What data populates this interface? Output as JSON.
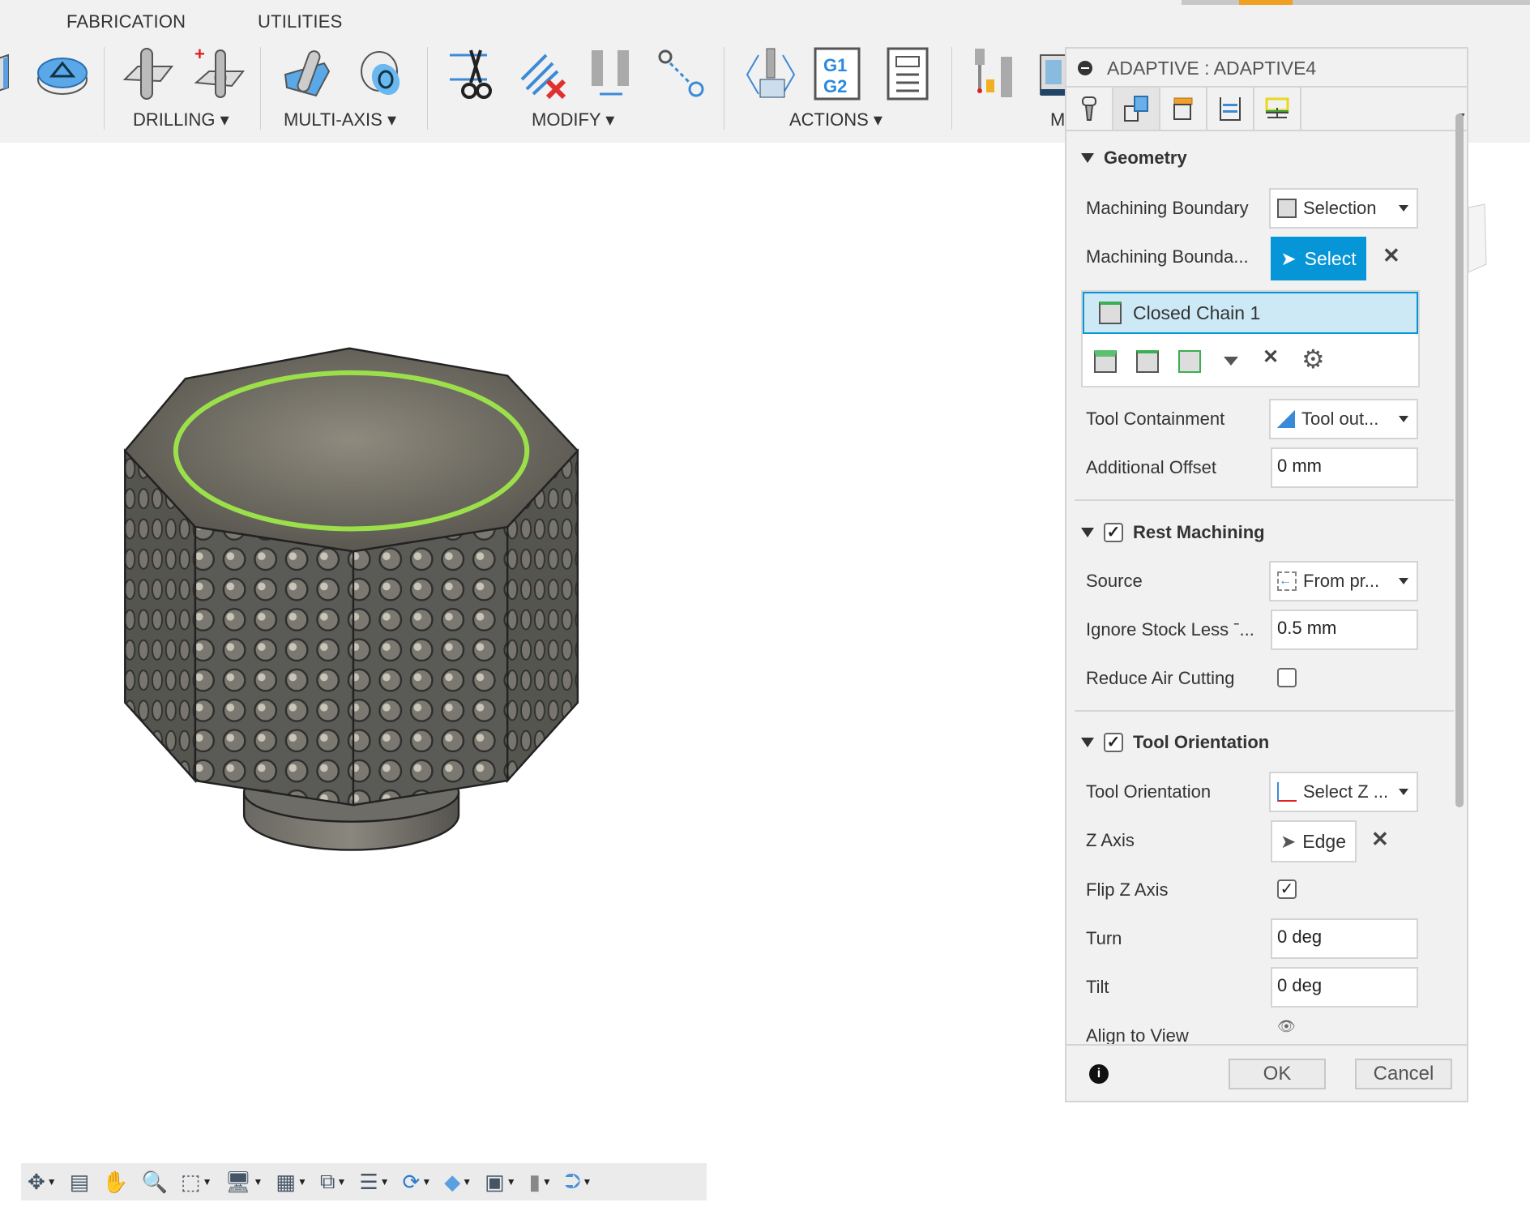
{
  "ribbon": {
    "tabs": [
      "FABRICATION",
      "UTILITIES"
    ],
    "groups": [
      "DRILLING",
      "MULTI-AXIS",
      "MODIFY",
      "ACTIONS",
      "M"
    ],
    "accent_color": "#f0a020"
  },
  "panel": {
    "title": "ADAPTIVE : ADAPTIVE4",
    "tabs": [
      "tool-icon",
      "geometry-icon",
      "heights-icon",
      "passes-icon",
      "linking-icon"
    ],
    "active_tab": 1,
    "geometry": {
      "header": "Geometry",
      "machining_boundary_label": "Machining Boundary",
      "machining_boundary_value": "Selection",
      "boundary_selection_label": "Machining Bounda...",
      "select_button": "Select",
      "select_color": "#0696d7",
      "chain_item": "Closed Chain 1",
      "tool_containment_label": "Tool Containment",
      "tool_containment_value": "Tool out...",
      "additional_offset_label": "Additional Offset",
      "additional_offset_value": "0 mm"
    },
    "rest_machining": {
      "header": "Rest Machining",
      "checked": true,
      "source_label": "Source",
      "source_value": "From pr...",
      "ignore_label": "Ignore Stock Less ˉ...",
      "ignore_value": "0.5 mm",
      "reduce_air_label": "Reduce Air Cutting",
      "reduce_air_checked": false
    },
    "tool_orientation": {
      "header": "Tool Orientation",
      "checked": true,
      "orientation_label": "Tool Orientation",
      "orientation_value": "Select Z ...",
      "z_axis_label": "Z Axis",
      "z_axis_value": "Edge",
      "flip_label": "Flip Z Axis",
      "flip_checked": true,
      "turn_label": "Turn",
      "turn_value": "0 deg",
      "tilt_label": "Tilt",
      "tilt_value": "0 deg",
      "align_label": "Align to View"
    },
    "ok": "OK",
    "cancel": "Cancel"
  },
  "navbar": {
    "icons": [
      "orbit-icon",
      "look-at-icon",
      "pan-icon",
      "zoom-icon",
      "fit-icon",
      "display-icon",
      "grid-icon",
      "view-cube-icon",
      "layers-icon",
      "refresh-icon",
      "visual-style-icon",
      "machine-icon",
      "tool-icon",
      "connect-icon"
    ]
  },
  "model": {
    "highlight_color": "#9be04a"
  }
}
